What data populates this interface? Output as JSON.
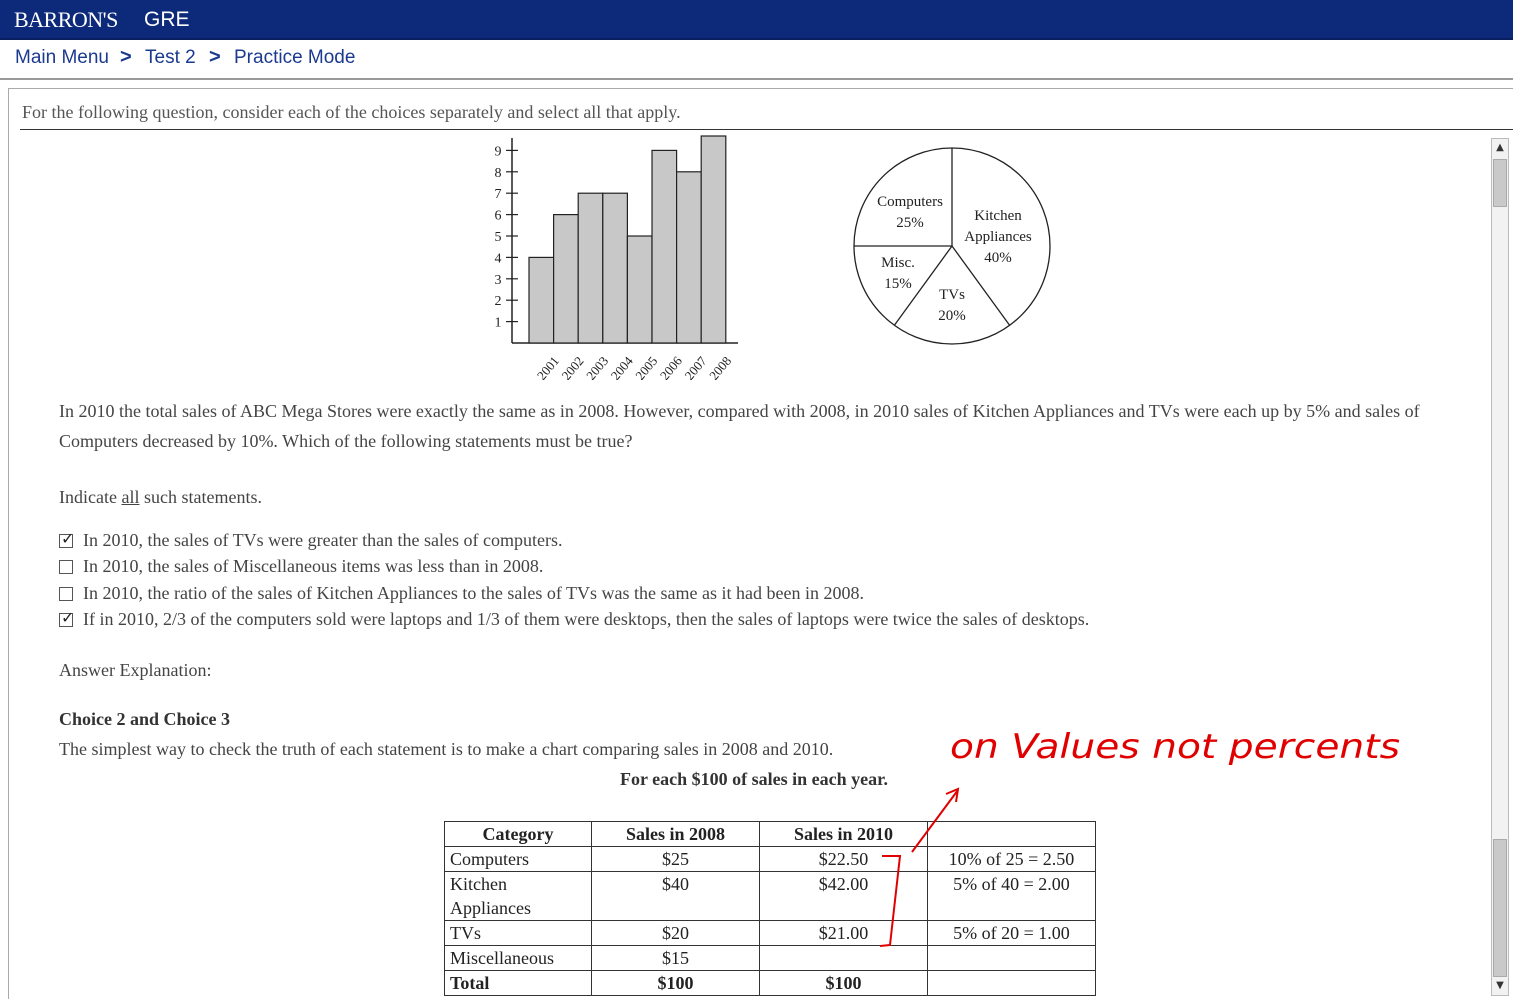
{
  "header": {
    "brand": "BARRON'S",
    "product": "GRE"
  },
  "breadcrumb": {
    "items": [
      "Main Menu",
      "Test 2",
      "Practice Mode"
    ],
    "separator": ">"
  },
  "instruction": "For the following question, consider each of the choices separately and select all that apply.",
  "chart_data": [
    {
      "type": "bar",
      "categories": [
        "2001",
        "2002",
        "2003",
        "2004",
        "2005",
        "2006",
        "2007",
        "2008"
      ],
      "values": [
        4,
        6,
        7,
        7,
        5,
        9,
        8,
        10
      ],
      "yticks": [
        1,
        2,
        3,
        4,
        5,
        6,
        7,
        8,
        9
      ],
      "ylim": [
        0,
        10
      ],
      "bar_color": "#c8c8c8"
    },
    {
      "type": "pie",
      "slices": [
        {
          "label": "Computers",
          "value": 25,
          "pct_label": "25%"
        },
        {
          "label": "Kitchen Appliances",
          "value": 40,
          "pct_label": "40%"
        },
        {
          "label": "TVs",
          "value": 20,
          "pct_label": "20%"
        },
        {
          "label": "Misc.",
          "value": 15,
          "pct_label": "15%"
        }
      ]
    }
  ],
  "question": {
    "text": "In 2010 the total sales of ABC Mega Stores were exactly the same as in 2008. However, compared with 2008, in 2010 sales of Kitchen Appliances and TVs were each up by 5% and sales of Computers decreased by 10%. Which of the following statements must be true?",
    "indicate_prefix": "Indicate ",
    "indicate_underlined": "all",
    "indicate_suffix": " such statements."
  },
  "choices": [
    {
      "label": "In 2010, the sales of TVs were greater than the sales of computers.",
      "checked": true
    },
    {
      "label": "In 2010, the sales of Miscellaneous items was less than in 2008.",
      "checked": false
    },
    {
      "label": "In 2010, the ratio of the sales of Kitchen Appliances to the sales of TVs was the same as it had been in 2008.",
      "checked": false
    },
    {
      "label": "If in 2010, 2/3 of the computers sold were laptops and 1/3 of them were desktops, then the sales of laptops were twice the sales of desktops.",
      "checked": true
    }
  ],
  "explanation": {
    "heading": "Answer Explanation:",
    "choice_title": "Choice 2 and Choice 3",
    "text": "The simplest way to check the truth of each statement is to make a chart comparing sales in 2008 and 2010.",
    "table_caption": "For each $100 of sales in each year."
  },
  "sales_table": {
    "headers": [
      "Category",
      "Sales in 2008",
      "Sales in 2010",
      ""
    ],
    "rows": [
      [
        "Computers",
        "$25",
        "$22.50",
        "10% of 25 = 2.50"
      ],
      [
        "Kitchen Appliances",
        "$40",
        "$42.00",
        "5% of 40 = 2.00"
      ],
      [
        "TVs",
        "$20",
        "$21.00",
        "5% of 20 = 1.00"
      ],
      [
        "Miscellaneous",
        "$15",
        "",
        ""
      ],
      [
        "Total",
        "$100",
        "$100",
        ""
      ]
    ]
  },
  "annotation": {
    "text": "on Values not percents",
    "color": "#e00000"
  },
  "colors": {
    "header_bg": "#0d2a7a",
    "link": "#1a3a8f"
  }
}
